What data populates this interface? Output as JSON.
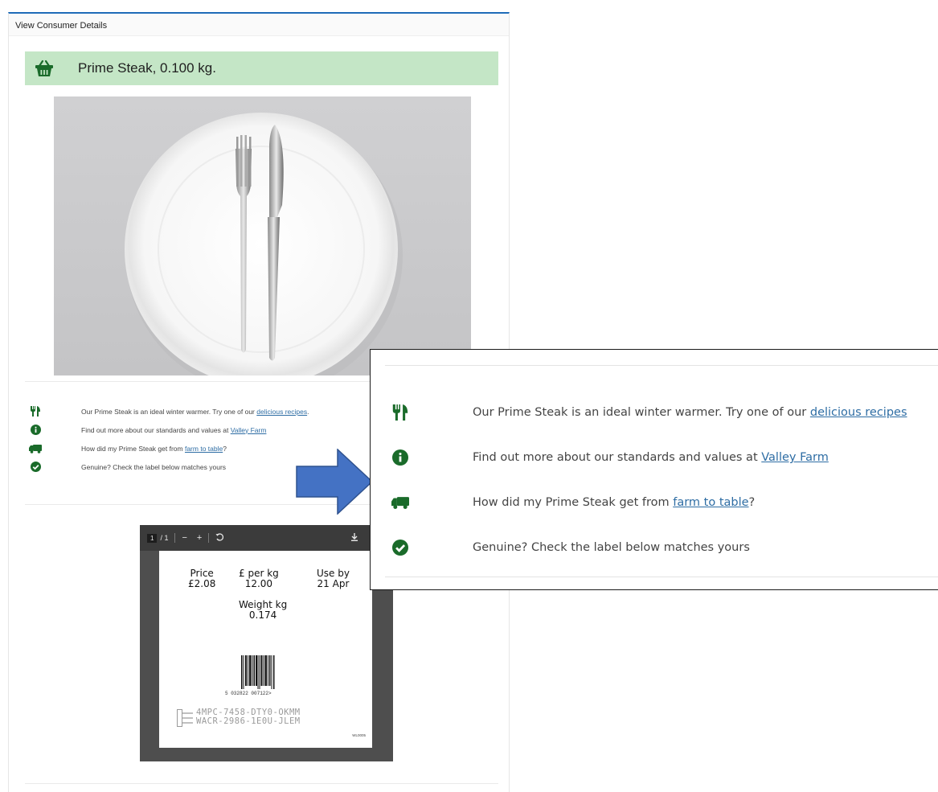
{
  "panel": {
    "title": "View Consumer Details"
  },
  "product": {
    "name": "Prime Steak, 0.100 kg."
  },
  "info_rows": [
    {
      "icon": "utensils-icon",
      "text_before": "Our Prime Steak is an ideal winter warmer. Try one of our ",
      "link": "delicious recipes",
      "text_after": "."
    },
    {
      "icon": "info-circle-icon",
      "text_before": "Find out more about our standards and values at ",
      "link": "Valley Farm",
      "text_after": ""
    },
    {
      "icon": "truck-icon",
      "text_before": "How did my Prime Steak get from ",
      "link": "farm to table",
      "text_after": "?"
    },
    {
      "icon": "check-circle-icon",
      "text_before": "Genuine? Check the label below matches yours",
      "link": "",
      "text_after": ""
    }
  ],
  "zoom_rows": [
    {
      "text_before": "Our Prime Steak is an ideal winter warmer. Try one of our ",
      "link": "delicious recipes",
      "text_after": ""
    },
    {
      "text_before": "Find out more about our standards and values at ",
      "link": "Valley Farm",
      "text_after": ""
    },
    {
      "text_before": "How did my Prime Steak get from ",
      "link": "farm to table",
      "text_after": "?"
    },
    {
      "text_before": "Genuine? Check the label below matches yours",
      "link": "",
      "text_after": ""
    }
  ],
  "pdf_viewer": {
    "current_page": "1",
    "total_pages": "/ 1",
    "zoom_out": "−",
    "zoom_in": "+",
    "label": {
      "price_label": "Price",
      "price_value": "£2.08",
      "per_kg_label": "£ per kg",
      "per_kg_value": "12.00",
      "use_by_label": "Use by",
      "use_by_value": "21 Apr",
      "weight_label": "Weight kg",
      "weight_value": "0.174",
      "barcode_number": "5 032822 007122>",
      "code_line_1": "4MPC-7458-DTY0-OKMM",
      "code_line_2": "WACR-2986-1E0U-JLEM",
      "page_id": "WL0005"
    }
  },
  "colors": {
    "banner_bg": "#c4e6c6",
    "icon_green": "#1a6b2a",
    "link_blue": "#2e6da4",
    "header_border": "#1e6bb8",
    "arrow_fill": "#4472c4"
  }
}
